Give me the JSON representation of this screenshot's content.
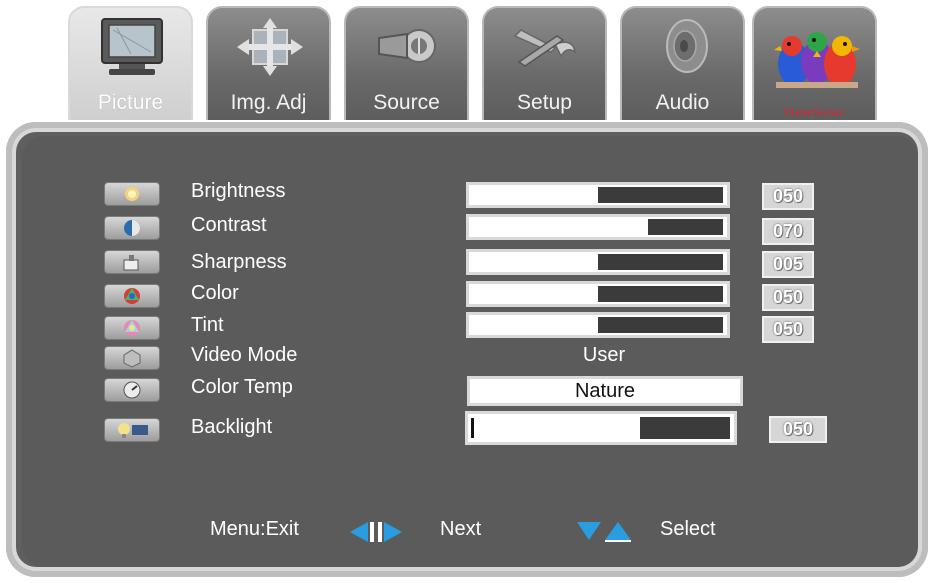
{
  "tabs": [
    {
      "label": "Picture",
      "icon": "tv-monitor-icon",
      "active": true
    },
    {
      "label": "Img. Adj",
      "icon": "move-arrows-icon",
      "active": false
    },
    {
      "label": "Source",
      "icon": "connector-plug-icon",
      "active": false
    },
    {
      "label": "Setup",
      "icon": "tools-icon",
      "active": false
    },
    {
      "label": "Audio",
      "icon": "speaker-icon",
      "active": false
    },
    {
      "label": "ViewSonic",
      "icon": "viewsonic-birds-logo",
      "active": false
    }
  ],
  "settings": [
    {
      "label": "Brightness",
      "value": "050",
      "level": 50,
      "icon": "brightness-icon"
    },
    {
      "label": "Contrast",
      "value": "070",
      "level": 70,
      "icon": "contrast-icon"
    },
    {
      "label": "Sharpness",
      "value": "005",
      "level": 50,
      "icon": "sharpness-icon"
    },
    {
      "label": "Color",
      "value": "050",
      "level": 50,
      "icon": "color-icon"
    },
    {
      "label": "Tint",
      "value": "050",
      "level": 50,
      "icon": "tint-icon"
    },
    {
      "label": "Video Mode",
      "value": "User",
      "icon": "video-mode-icon"
    },
    {
      "label": "Color Temp",
      "value": "Nature",
      "icon": "color-temp-icon"
    },
    {
      "label": "Backlight",
      "value": "050",
      "level": 50,
      "icon": "backlight-icon"
    }
  ],
  "footer": {
    "exit": "Menu:Exit",
    "next": "Next",
    "select": "Select"
  },
  "colors": {
    "panel": "#5b5b5b",
    "tab": "#6a6a6a",
    "active_tab": "#d6d6d6",
    "slider_fill": "#3b3b3b",
    "arrow_blue": "#2a9de0"
  }
}
